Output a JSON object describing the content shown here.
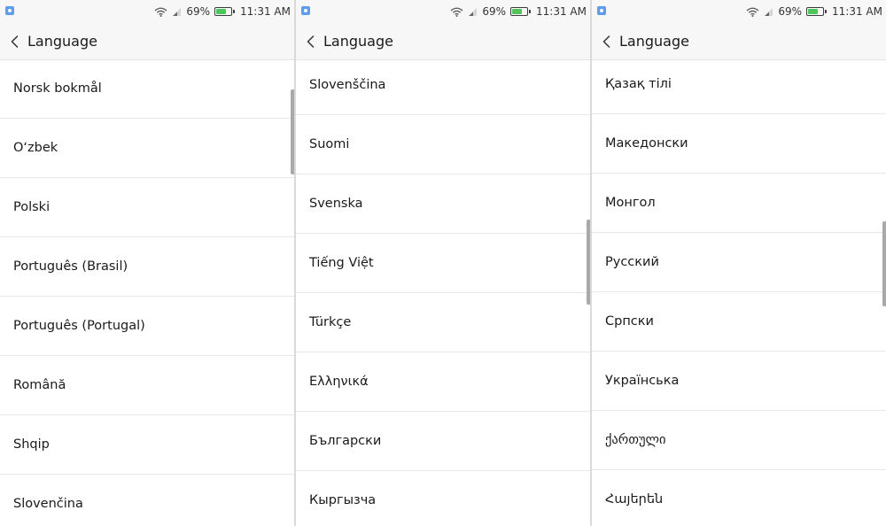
{
  "status_bar": {
    "battery": "69%",
    "battery_level": 0.69,
    "time": "11:31 AM",
    "icons": [
      "app-notification-icon",
      "wifi-icon",
      "signal-icon",
      "battery-icon"
    ]
  },
  "header": {
    "title": "Language",
    "back_icon": "chevron-left-icon"
  },
  "screens": [
    {
      "items": [
        "Norsk bokmål",
        "O‘zbek",
        "Polski",
        "Português (Brasil)",
        "Português (Portugal)",
        "Română",
        "Shqip",
        "Slovenčina"
      ]
    },
    {
      "items": [
        "Slovenščina",
        "Suomi",
        "Svenska",
        "Tiếng Việt",
        "Türkçe",
        "Ελληνικά",
        "Български",
        "Кыргызча"
      ]
    },
    {
      "items": [
        "Қазақ тілі",
        "Македонски",
        "Монгол",
        "Русский",
        "Српски",
        "Українська",
        "ქართული",
        "Հայերեն"
      ]
    }
  ],
  "colors": {
    "battery_fill": "#4fc65a",
    "app_icon": "#5c9ded",
    "scrollbar": "#a9a9a9"
  }
}
